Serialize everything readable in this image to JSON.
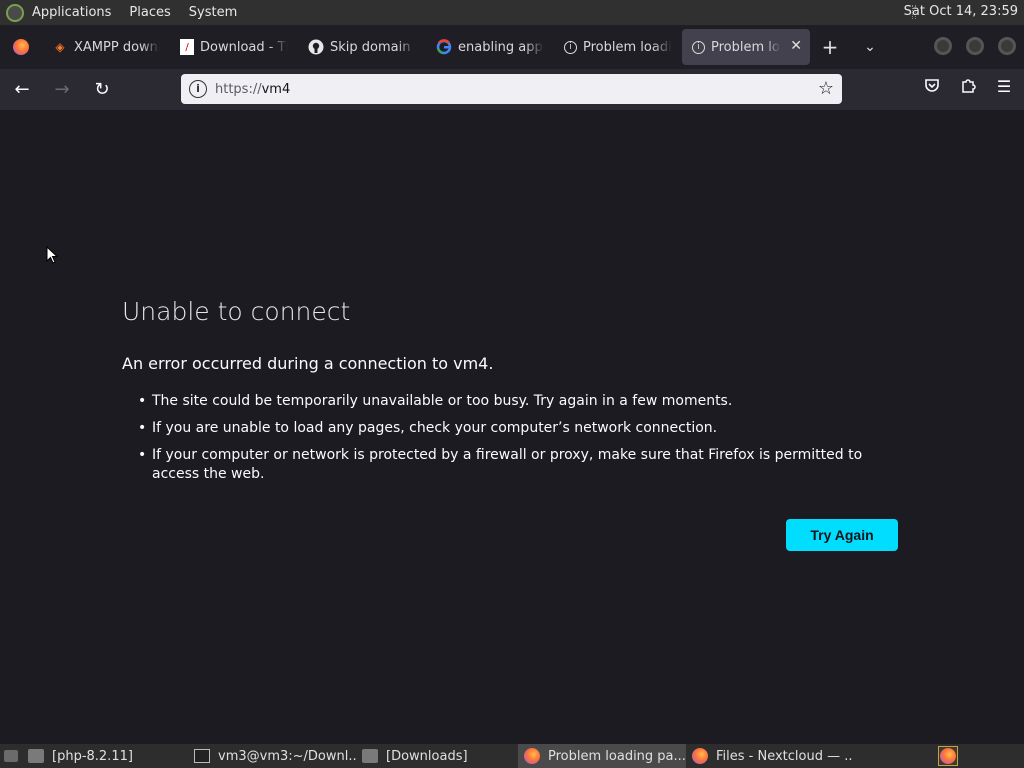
{
  "topbar": {
    "menus": [
      "Applications",
      "Places",
      "System"
    ],
    "clock": "Sat Oct 14, 23:59"
  },
  "tabs": [
    {
      "label": "XAMPP downl",
      "icon": "xampp-icon"
    },
    {
      "label": "Download - Th",
      "icon": "page-icon"
    },
    {
      "label": "Skip domain v",
      "icon": "github-icon"
    },
    {
      "label": "enabling apps",
      "icon": "google-icon"
    },
    {
      "label": "Problem loadi",
      "icon": "info-icon"
    },
    {
      "label": "Problem lo",
      "icon": "info-icon",
      "active": true
    }
  ],
  "navbar": {
    "url_scheme": "https://",
    "url_host": "vm4"
  },
  "error": {
    "title": "Unable to connect",
    "description": "An error occurred during a connection to vm4.",
    "bullets": [
      "The site could be temporarily unavailable or too busy. Try again in a few moments.",
      "If you are unable to load any pages, check your computer’s network connection.",
      "If your computer or network is protected by a firewall or proxy, make sure that Firefox is permitted to access the web."
    ],
    "button": "Try Again"
  },
  "taskbar": {
    "items": [
      {
        "label": "[php-8.2.11]",
        "icon": "folder-icon"
      },
      {
        "label": "vm3@vm3:~/Downl...",
        "icon": "terminal-icon"
      },
      {
        "label": "[Downloads]",
        "icon": "folder-icon"
      },
      {
        "label": "Problem loading pa...",
        "icon": "firefox-icon",
        "active": true
      },
      {
        "label": "Files - Nextcloud — ...",
        "icon": "firefox-icon"
      }
    ]
  },
  "colors": {
    "accent_button": "#00ddff",
    "page_bg": "#1c1b22"
  }
}
